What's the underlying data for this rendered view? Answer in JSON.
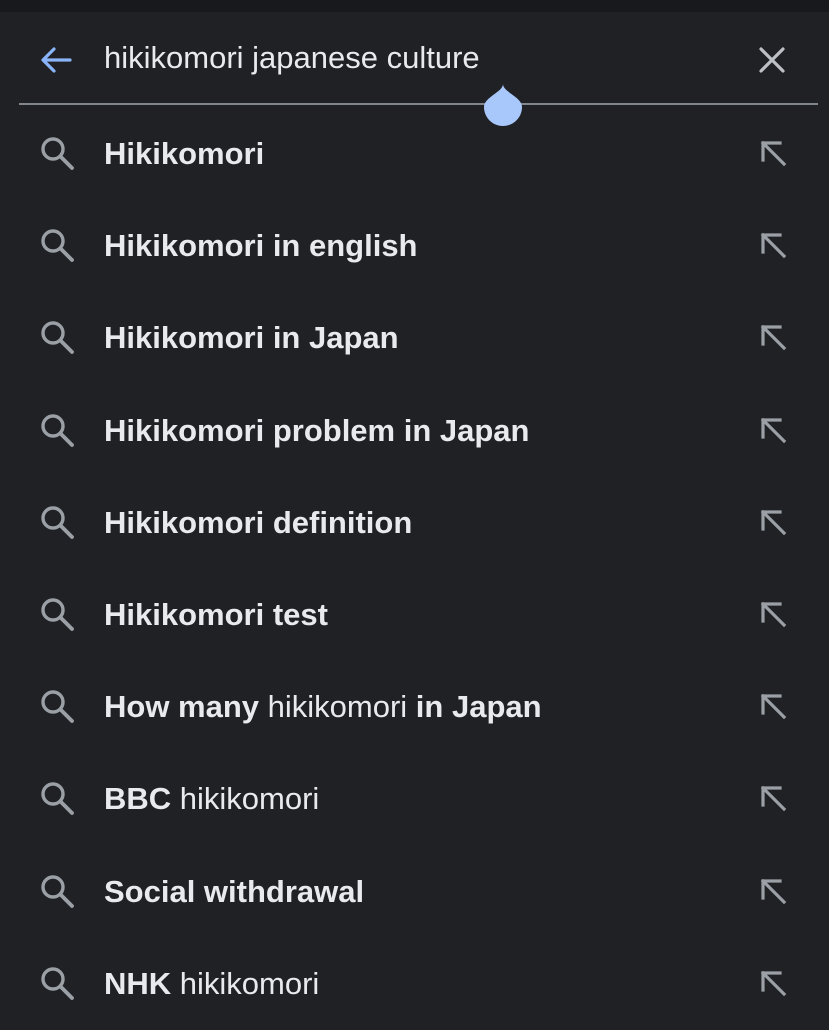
{
  "search": {
    "query": "hikikomori japanese culture",
    "back_icon": "arrow-back-icon",
    "clear_icon": "close-icon"
  },
  "colors": {
    "background": "#202124",
    "text": "#e8eaed",
    "icon": "#9aa0a6",
    "accent": "#8ab4f8",
    "handle": "#a8c7fa"
  },
  "suggestions": [
    {
      "parts": [
        {
          "text": "Hikikomori",
          "bold": true
        }
      ]
    },
    {
      "parts": [
        {
          "text": "Hikikomori in english",
          "bold": true
        }
      ]
    },
    {
      "parts": [
        {
          "text": "Hikikomori in Japan",
          "bold": true
        }
      ]
    },
    {
      "parts": [
        {
          "text": "Hikikomori problem in Japan",
          "bold": true
        }
      ]
    },
    {
      "parts": [
        {
          "text": "Hikikomori definition",
          "bold": true
        }
      ]
    },
    {
      "parts": [
        {
          "text": "Hikikomori test",
          "bold": true
        }
      ]
    },
    {
      "parts": [
        {
          "text": "How many ",
          "bold": true
        },
        {
          "text": "hikikomori",
          "bold": false
        },
        {
          "text": " in Japan",
          "bold": true
        }
      ]
    },
    {
      "parts": [
        {
          "text": "BBC",
          "bold": true
        },
        {
          "text": " hikikomori",
          "bold": false
        }
      ]
    },
    {
      "parts": [
        {
          "text": "Social withdrawal",
          "bold": true
        }
      ]
    },
    {
      "parts": [
        {
          "text": "NHK",
          "bold": true
        },
        {
          "text": " hikikomori",
          "bold": false
        }
      ]
    }
  ]
}
